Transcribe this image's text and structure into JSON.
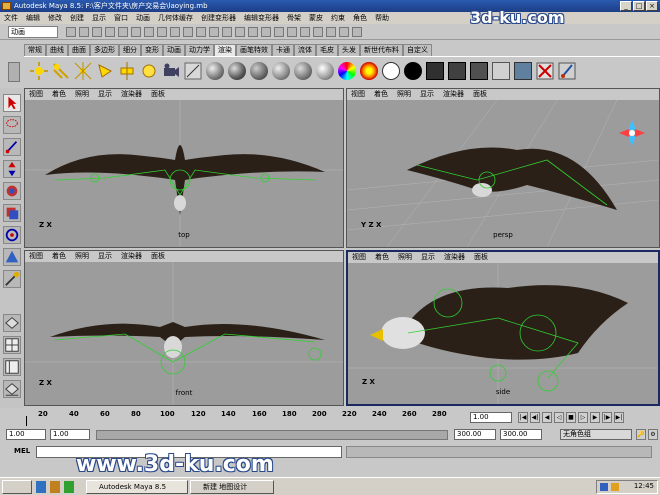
{
  "window": {
    "title": "Autodesk Maya 8.5: F:\\客户文件夹\\房产交易会\\laoying.mb",
    "min": "_",
    "max": "□",
    "close": "×"
  },
  "menu": [
    "文件",
    "编辑",
    "修改",
    "创建",
    "显示",
    "窗口",
    "动画",
    "几何体缓存",
    "创建变形器",
    "编辑变形器",
    "骨架",
    "蒙皮",
    "约束",
    "角色",
    "帮助"
  ],
  "status": {
    "mode": "动画"
  },
  "shelf_tabs": {
    "labels": [
      "常规",
      "曲线",
      "曲面",
      "多边形",
      "细分",
      "变形",
      "动画",
      "动力学",
      "渲染",
      "画笔特效",
      "卡通",
      "流体",
      "毛皮",
      "头发",
      "新世代布料",
      "自定义"
    ],
    "active_index": 8
  },
  "panel_menu": [
    "视图",
    "着色",
    "照明",
    "显示",
    "渲染器",
    "面板"
  ],
  "viewports": [
    {
      "camera": "top",
      "axis": "Z X"
    },
    {
      "camera": "persp",
      "axis": "Y Z X"
    },
    {
      "camera": "front",
      "axis": "Z X"
    },
    {
      "camera": "side",
      "axis": "Z X"
    }
  ],
  "timeline": {
    "ticks": [
      "20",
      "40",
      "60",
      "80",
      "100",
      "120",
      "140",
      "160",
      "180",
      "200",
      "220",
      "240",
      "260",
      "280"
    ],
    "current_frame": "1.00"
  },
  "range": {
    "start": "1.00",
    "inner_start": "1.00",
    "inner_end": "300.00",
    "end": "300.00",
    "character_set": "无角色组"
  },
  "command_line": {
    "label": "MEL"
  },
  "taskbar": {
    "tasks": [
      "Autodesk Maya 8.5",
      "新建 地图设计"
    ],
    "clock": "12:45"
  },
  "watermarks": [
    "3d-ku.com",
    "www.3d-ku.com"
  ],
  "colors": {
    "title": "#1c3e86",
    "viewport": "#9c9c9c"
  }
}
